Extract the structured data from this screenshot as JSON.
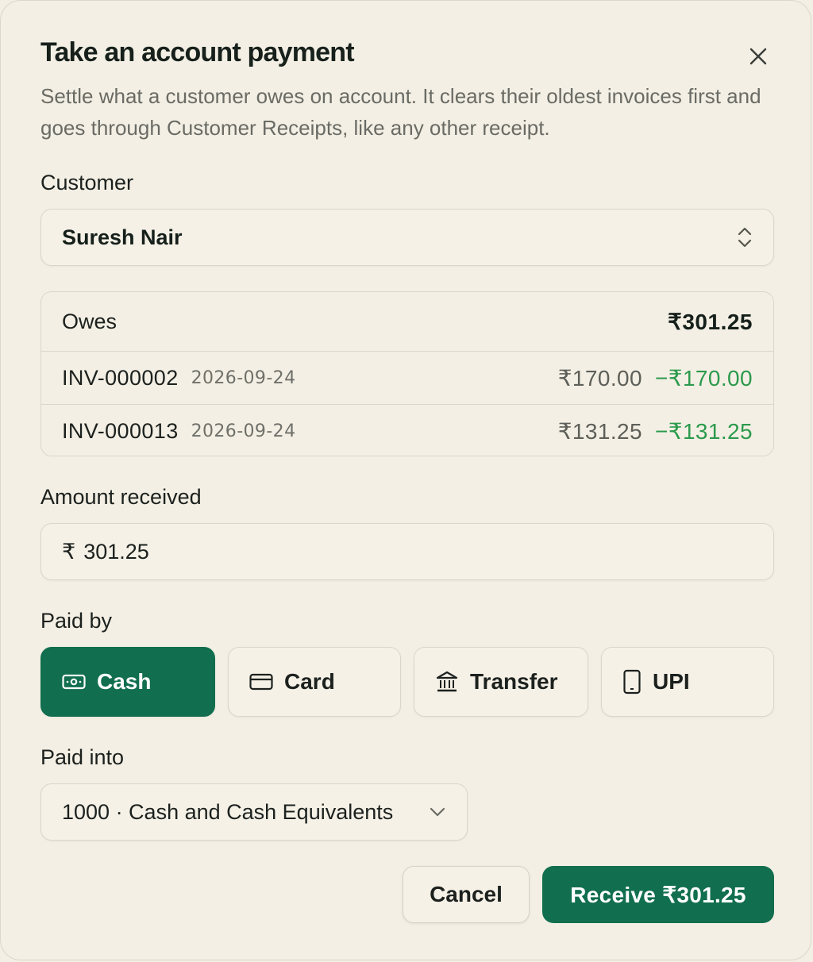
{
  "dialog": {
    "title": "Take an account payment",
    "subtitle": "Settle what a customer owes on account. It clears their oldest invoices first and goes through Customer Receipts, like any other receipt.",
    "close_icon": "close-icon"
  },
  "customer": {
    "label": "Customer",
    "selected": "Suresh Nair",
    "icon": "chevron-up-down-icon"
  },
  "owes": {
    "label": "Owes",
    "total": "₹301.25",
    "invoices": [
      {
        "id": "INV-000002",
        "date": "2026-09-24",
        "amount": "₹170.00",
        "applied": "−₹170.00"
      },
      {
        "id": "INV-000013",
        "date": "2026-09-24",
        "amount": "₹131.25",
        "applied": "−₹131.25"
      }
    ]
  },
  "amount": {
    "label": "Amount received",
    "currency": "₹",
    "value": "301.25"
  },
  "paid_by": {
    "label": "Paid by",
    "selected": "Cash",
    "methods": [
      {
        "label": "Cash",
        "icon": "cash-icon"
      },
      {
        "label": "Card",
        "icon": "card-icon"
      },
      {
        "label": "Transfer",
        "icon": "bank-icon"
      },
      {
        "label": "UPI",
        "icon": "phone-icon"
      }
    ]
  },
  "paid_into": {
    "label": "Paid into",
    "selected": "1000 · Cash and Cash Equivalents",
    "icon": "chevron-down-icon"
  },
  "actions": {
    "cancel": "Cancel",
    "receive": "Receive ₹301.25"
  },
  "colors": {
    "background": "#f3efe4",
    "accent": "#116e4f",
    "applied_green": "#2b9a4c",
    "border": "#dbd6c9"
  }
}
